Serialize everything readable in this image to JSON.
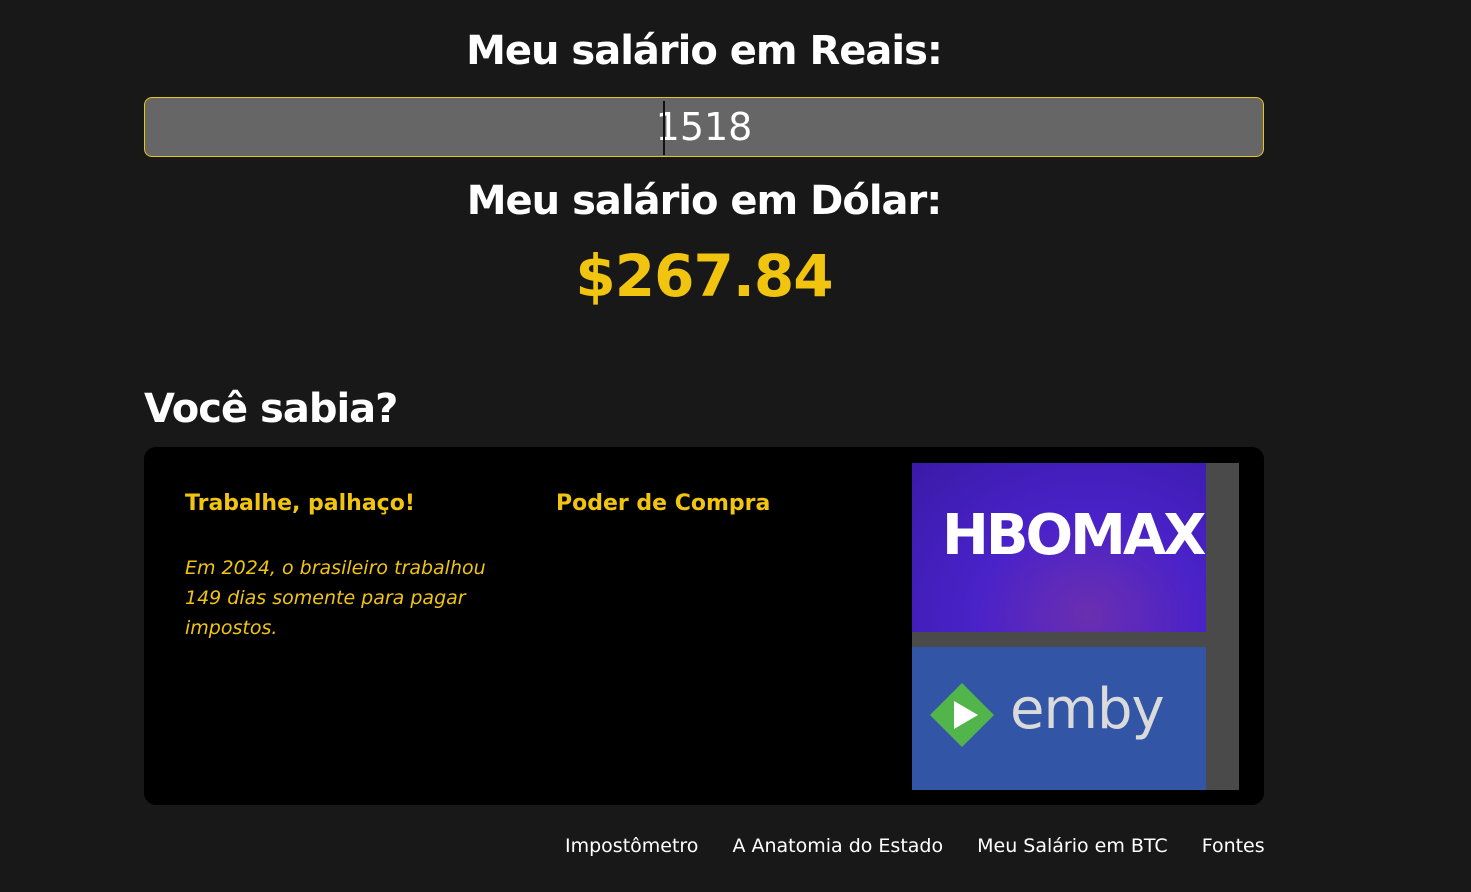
{
  "converter": {
    "reais_heading": "Meu salário em Reais:",
    "reais_value": "1518",
    "dolar_heading": "Meu salário em Dólar:",
    "dolar_value": "$267.84"
  },
  "facts": {
    "section_title": "Você sabia?",
    "col1_title": "Trabalhe, palhaço!",
    "col1_text": "Em 2024, o brasileiro trabalhou 149 dias somente para pagar impostos.",
    "col2_title": "Poder de Compra",
    "media": [
      {
        "name": "HBOMAX",
        "icon": "hbomax-logo"
      },
      {
        "name": "emby",
        "icon": "emby-logo"
      }
    ]
  },
  "footer": {
    "links": [
      "Impostômetro",
      "A Anatomia do Estado",
      "Meu Salário em BTC",
      "Fontes"
    ]
  },
  "colors": {
    "background": "#181818",
    "accent": "#f1c40f",
    "input_bg": "#666666",
    "card_bg": "#000000"
  }
}
